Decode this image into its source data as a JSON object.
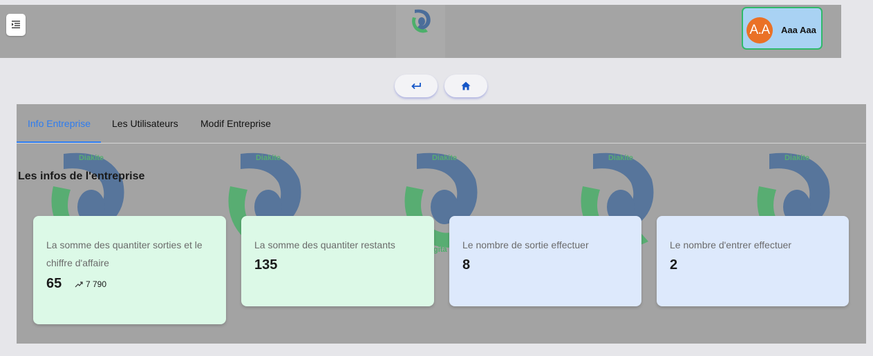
{
  "header": {
    "menu_icon": "menu-indent-icon",
    "logo_icon": "brand-logo-icon",
    "user": {
      "initials": "A.A",
      "name": "Aaa Aaa",
      "avatar_color": "#ea7126",
      "border_color": "#30b96a"
    }
  },
  "nav": {
    "back_icon": "return-arrow-icon",
    "home_icon": "home-icon",
    "icon_color": "#1456c8"
  },
  "tabs": [
    {
      "label": "Info Entreprise",
      "active": true
    },
    {
      "label": "Les Utilisateurs",
      "active": false
    },
    {
      "label": "Modif Entreprise",
      "active": false
    }
  ],
  "watermark": {
    "text": "Diakite",
    "partial_text": "igita"
  },
  "section": {
    "title": "Les infos de l'entreprise"
  },
  "cards": [
    {
      "label": "La somme des quantiter sorties et le chiffre d'affaire",
      "value": "65",
      "trend_icon": "trending-up-icon",
      "trend_value": "7 790",
      "color": "#dcf9e7"
    },
    {
      "label": "La somme des quantiter restants",
      "value": "135",
      "color": "#dcf9e7"
    },
    {
      "label": "Le nombre de sortie effectuer",
      "value": "8",
      "color": "#dde9fc"
    },
    {
      "label": "Le nombre d'entrer effectuer",
      "value": "2",
      "color": "#dde9fc"
    }
  ],
  "colors": {
    "accent": "#2d7cf0",
    "logo_green": "#4caf6a",
    "logo_blue": "#4a6d9a"
  }
}
